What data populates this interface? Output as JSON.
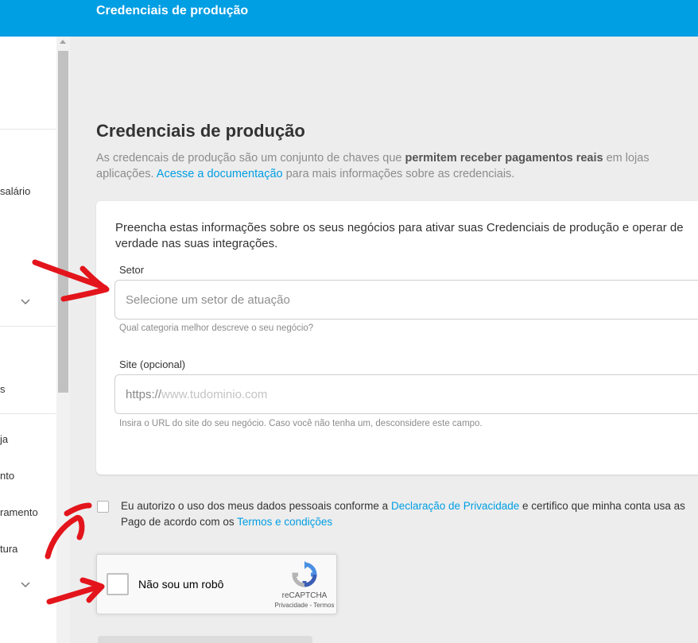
{
  "header": {
    "title": "Credenciais de produção"
  },
  "sidebar": {
    "items": [
      {
        "label": "salário"
      },
      {
        "label": "s"
      },
      {
        "label": "ja"
      },
      {
        "label": "nto"
      },
      {
        "label": "ramento"
      },
      {
        "label": "tura"
      }
    ]
  },
  "main": {
    "title": "Credenciais de produção",
    "description": {
      "part1": "As credencais de produção são um conjunto de chaves que ",
      "bold": "permitem receber pagamentos reais",
      "part2": " em lojas",
      "part3": "aplicações. ",
      "link": "Acesse a documentação",
      "part4": " para mais informações sobre as credenciais."
    },
    "card": {
      "intro": "Preencha estas informações sobre os seus negócios para ativar suas Credenciais de produção e operar de verdade nas suas integrações.",
      "sector": {
        "label": "Setor",
        "placeholder": "Selecione um setor de atuação",
        "help": "Qual categoria melhor descreve o seu negócio?"
      },
      "site": {
        "label": "Site (opcional)",
        "prefix": "https://",
        "placeholder": "www.tudominio.com",
        "help": "Insira o URL do site do seu negócio. Caso você não tenha um, desconsidere este campo."
      }
    },
    "consent": {
      "part1": "Eu autorizo o uso dos meus dados pessoais conforme a ",
      "privacy_link": "Declaração de Privacidade",
      "part2": " e certifico que minha conta usa as",
      "part3": "Pago de acordo com os ",
      "terms_link": "Termos e condições"
    },
    "recaptcha": {
      "label": "Não sou um robô",
      "brand": "reCAPTCHA",
      "terms": "Privacidade - Termos"
    }
  },
  "colors": {
    "brand": "#009ee3",
    "annotation": "#e3141b"
  }
}
